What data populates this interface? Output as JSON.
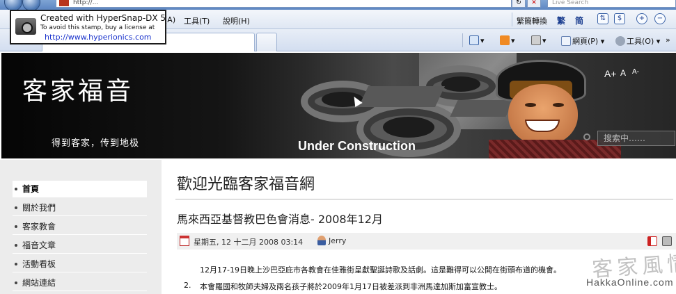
{
  "browser": {
    "address_url": "http://...",
    "live_search_placeholder": "Live Search",
    "go_glyph": "↻",
    "stop_glyph": "✕",
    "menu": [
      "(A)",
      "工具(T)",
      "說明(H)"
    ],
    "conversion": {
      "label": "繁簡轉換",
      "traditional": "繁",
      "simplified": "简"
    },
    "commands": {
      "page": "網頁(P)",
      "tools": "工具(O)"
    }
  },
  "stamp": {
    "line1": "Created with HyperSnap-DX 5",
    "line2": "To avoid this stamp, buy a license at",
    "line3": "http://www.hyperionics.com"
  },
  "banner": {
    "title": "客家福音",
    "slogan": "得到客家，传到地极",
    "under_construction": "Under Construction",
    "font_controls": [
      "A+",
      "A",
      "A-"
    ],
    "search_placeholder": "搜索中……"
  },
  "sidebar": {
    "items": [
      {
        "label": "首頁",
        "active": true
      },
      {
        "label": "關於我們",
        "active": false
      },
      {
        "label": "客家教會",
        "active": false
      },
      {
        "label": "福音文章",
        "active": false
      },
      {
        "label": "活動看板",
        "active": false
      },
      {
        "label": "網站連結",
        "active": false
      }
    ]
  },
  "main": {
    "welcome": "歡迎光臨客家福音網",
    "article": {
      "title": "馬來西亞基督教巴色會消息- 2008年12月",
      "date": "星期五, 12 十二月 2008 03:14",
      "author": "Jerry",
      "paragraphs": [
        {
          "num": "",
          "text": "12月17-19日晚上沙巴亞庇市各教會在佳雅街呈獻聖誕詩歌及話劇。這是難得可以公開在街頭布道的機會。"
        },
        {
          "num": "2.",
          "text": "本會羅國和牧師夫婦及兩名孩子將於2009年1月17日被差派到非洲馬達加斯加富宣教士。"
        }
      ]
    }
  },
  "watermark": {
    "chinese": "客家風情",
    "english": "HakkaOnline.com"
  }
}
